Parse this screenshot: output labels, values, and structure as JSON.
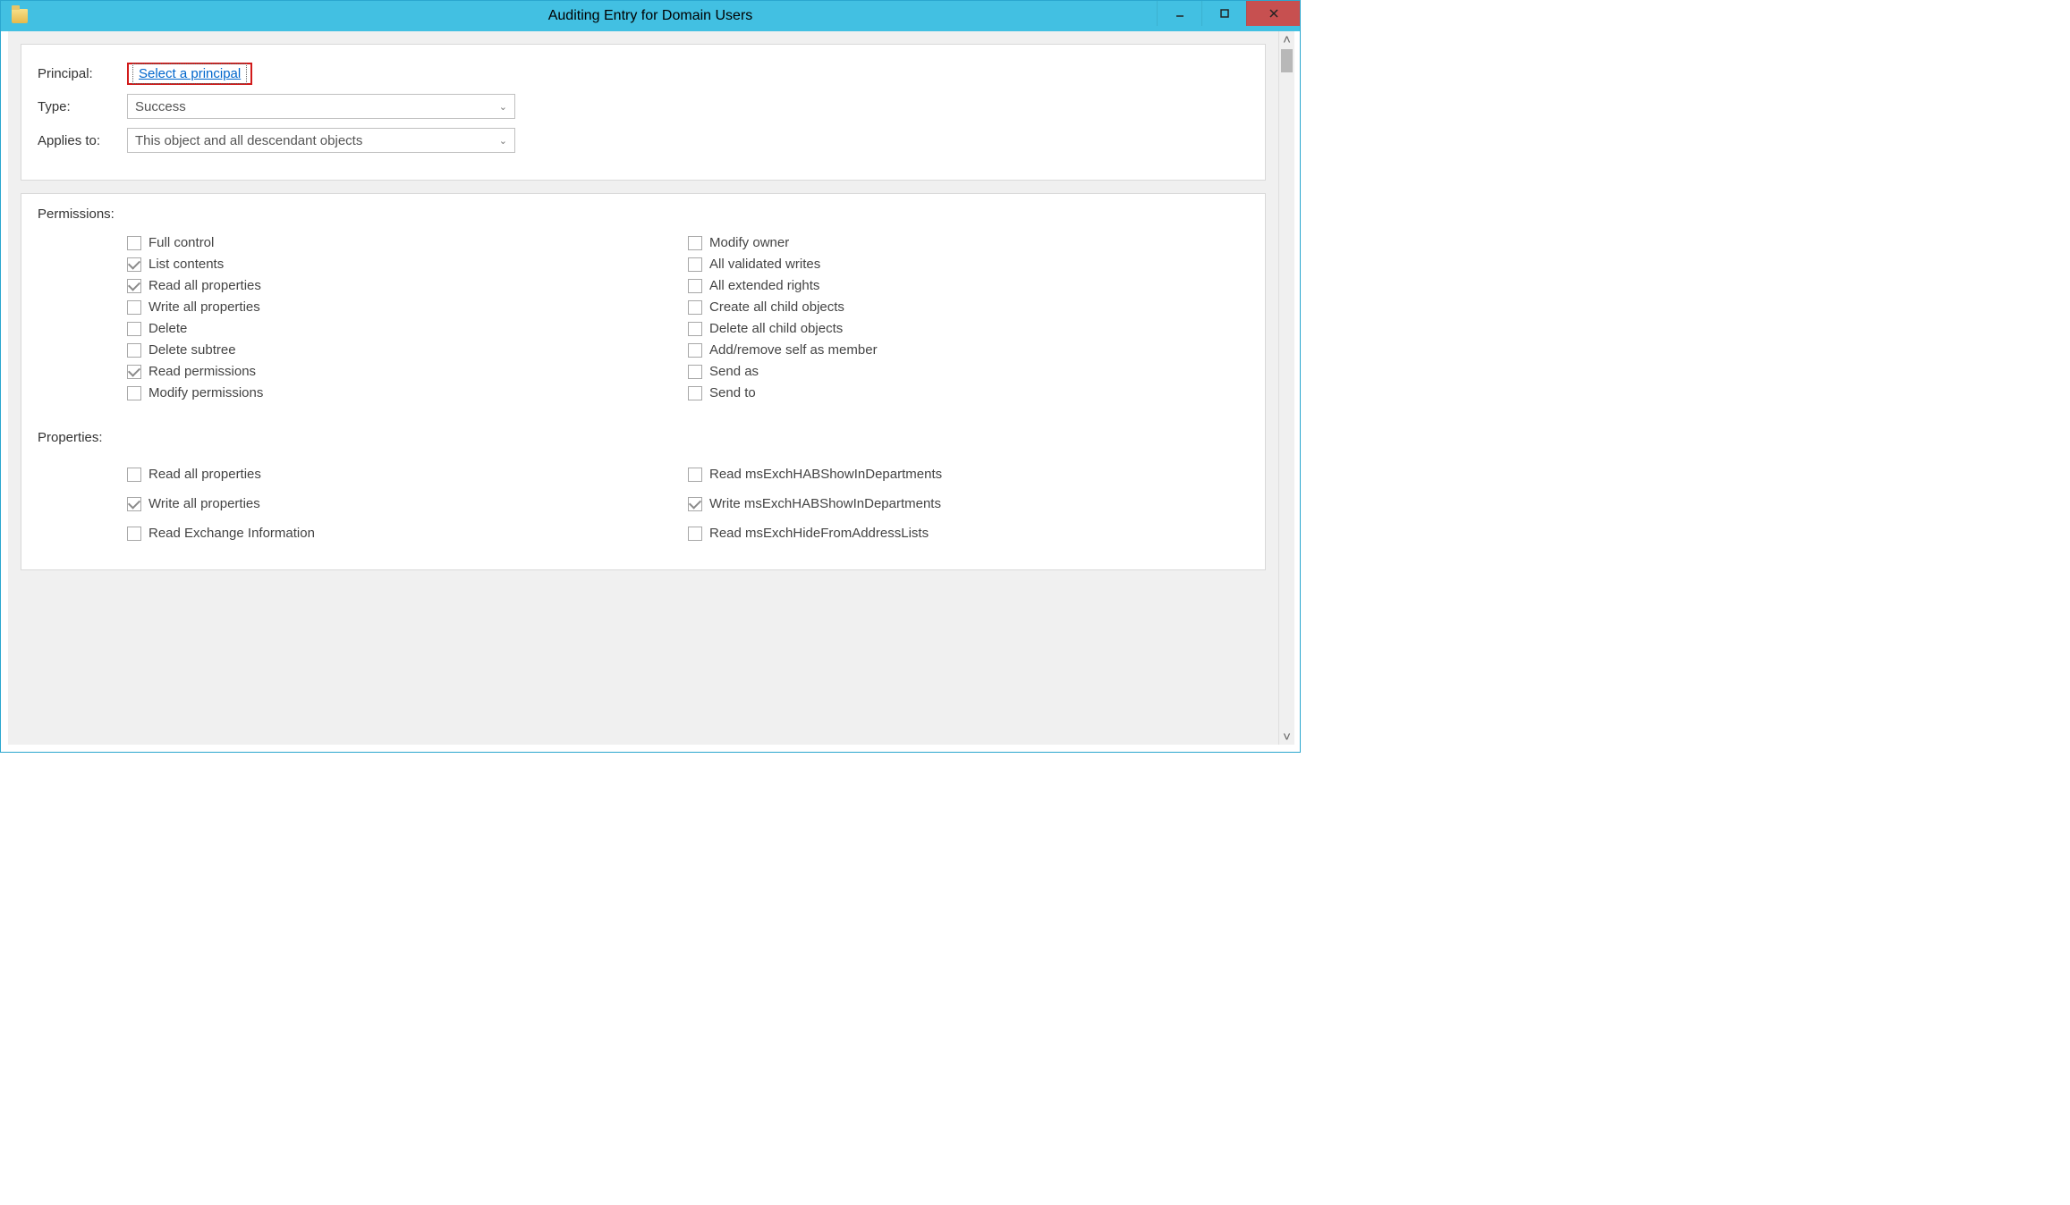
{
  "window": {
    "title": "Auditing Entry for Domain Users"
  },
  "top_panel": {
    "principal_label": "Principal:",
    "principal_link": "Select a principal",
    "type_label": "Type:",
    "type_value": "Success",
    "applies_label": "Applies to:",
    "applies_value": "This object and all descendant objects"
  },
  "permissions": {
    "title": "Permissions:",
    "left": [
      {
        "label": "Full control",
        "checked": false
      },
      {
        "label": "List contents",
        "checked": true
      },
      {
        "label": "Read all properties",
        "checked": true
      },
      {
        "label": "Write all properties",
        "checked": false
      },
      {
        "label": "Delete",
        "checked": false
      },
      {
        "label": "Delete subtree",
        "checked": false
      },
      {
        "label": "Read permissions",
        "checked": true
      },
      {
        "label": "Modify permissions",
        "checked": false
      }
    ],
    "right": [
      {
        "label": "Modify owner",
        "checked": false
      },
      {
        "label": "All validated writes",
        "checked": false
      },
      {
        "label": "All extended rights",
        "checked": false
      },
      {
        "label": "Create all child objects",
        "checked": false
      },
      {
        "label": "Delete all child objects",
        "checked": false
      },
      {
        "label": "Add/remove self as member",
        "checked": false
      },
      {
        "label": "Send as",
        "checked": false
      },
      {
        "label": "Send to",
        "checked": false
      }
    ]
  },
  "properties": {
    "title": "Properties:",
    "left": [
      {
        "label": "Read all properties",
        "checked": false
      },
      {
        "label": "Write all properties",
        "checked": true
      },
      {
        "label": "Read Exchange Information",
        "checked": false
      }
    ],
    "right": [
      {
        "label": "Read msExchHABShowInDepartments",
        "checked": false
      },
      {
        "label": "Write msExchHABShowInDepartments",
        "checked": true
      },
      {
        "label": "Read msExchHideFromAddressLists",
        "checked": false
      }
    ]
  }
}
